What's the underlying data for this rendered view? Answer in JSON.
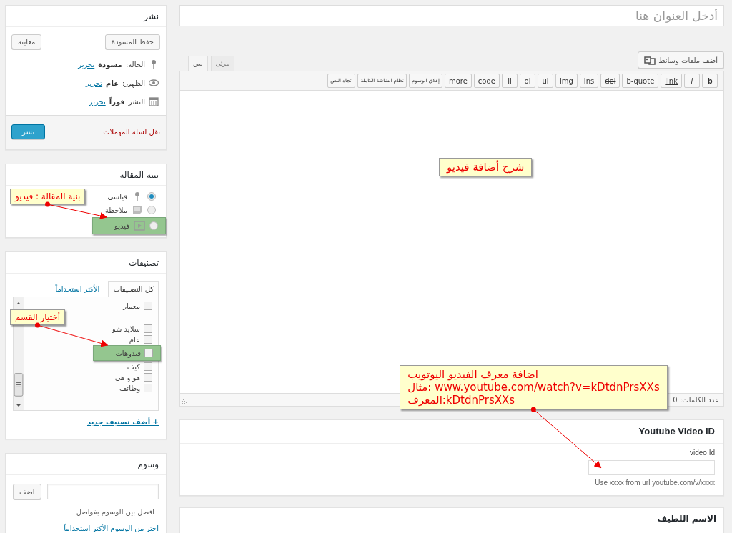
{
  "publish_box": {
    "title": "نشر",
    "save_draft": "حفظ المسودة",
    "preview": "معاينة",
    "meta": [
      {
        "kind": "status",
        "label": "الحالة:",
        "value": "مسودة",
        "link": "تحرير"
      },
      {
        "kind": "visibility",
        "label": "الظهور:",
        "value": "عام",
        "link": "تحرير"
      },
      {
        "kind": "schedule",
        "label": "النشر",
        "value": "فوراً",
        "link": "تحرير"
      }
    ],
    "trash": "نقل لسلة المهملات",
    "publish": "نشر"
  },
  "format_box": {
    "title": "بنية المقالة",
    "options": [
      {
        "label": "قياسي",
        "kind": "standard",
        "selected": true,
        "highlighted": false
      },
      {
        "label": "ملاحظة",
        "kind": "note",
        "selected": false,
        "highlighted": false
      },
      {
        "label": "فيديو",
        "kind": "video",
        "selected": false,
        "highlighted": true
      }
    ]
  },
  "categories_box": {
    "title": "تصنيفات",
    "tabs": [
      {
        "label": "كل التصنيفات",
        "selected": true
      },
      {
        "label": "الأكثر استخداماً",
        "selected": false
      }
    ],
    "items": [
      {
        "label": "معمار",
        "checked": false,
        "highlighted": false
      },
      {
        "label": "سلايد شو",
        "checked": false,
        "highlighted": false
      },
      {
        "label": "عام",
        "checked": false,
        "highlighted": false
      },
      {
        "label": "فيدوهات",
        "checked": false,
        "highlighted": true
      },
      {
        "label": "كيف",
        "checked": false,
        "highlighted": false
      },
      {
        "label": "هو و هي",
        "checked": false,
        "highlighted": false
      },
      {
        "label": "وظائف",
        "checked": false,
        "highlighted": false
      }
    ],
    "add_link": "+ أضف تصنيف جديد"
  },
  "tags_box": {
    "title": "وسوم",
    "add_button": "اضف",
    "hint": "افصل بين الوسوم بفواصل",
    "choose_link": "اختر من الوسوم الأكثر استخداماً"
  },
  "editor": {
    "title_placeholder": "أدخل العنوان هنا",
    "add_media": "أضف ملفات وسائط",
    "tabs": [
      {
        "label": "مرئي",
        "selected": false
      },
      {
        "label": "نص",
        "selected": true
      }
    ],
    "toolbar": [
      "b",
      "i",
      "link",
      "b-quote",
      "del",
      "ins",
      "img",
      "ul",
      "ol",
      "li",
      "code",
      "more",
      "إغلاق الوسوم",
      "نظام الشاشة الكاملة",
      "اتجاه النص"
    ],
    "word_count": "عدد الكلمات: 0"
  },
  "youtube_box": {
    "title": "Youtube Video ID",
    "field_label": "video Id",
    "help": "Use xxxx from url youtube.com/v/xxxx"
  },
  "slug_box": {
    "title": "الاسم اللطيف"
  },
  "callouts": [
    {
      "lines": [
        "بنية المقالة : فيديو"
      ],
      "arrow": true
    },
    {
      "lines": [
        "أختيار القسم"
      ],
      "arrow": true
    },
    {
      "lines": [
        "شرح أضافة فيديو"
      ]
    },
    {
      "lines": [
        "اضافة معرف الفيديو اليوتويب",
        "مثال: www.youtube.com/watch?v=kDtdnPrsXXs",
        "المعرف:kDtdnPrsXXs"
      ],
      "arrow": true
    }
  ]
}
